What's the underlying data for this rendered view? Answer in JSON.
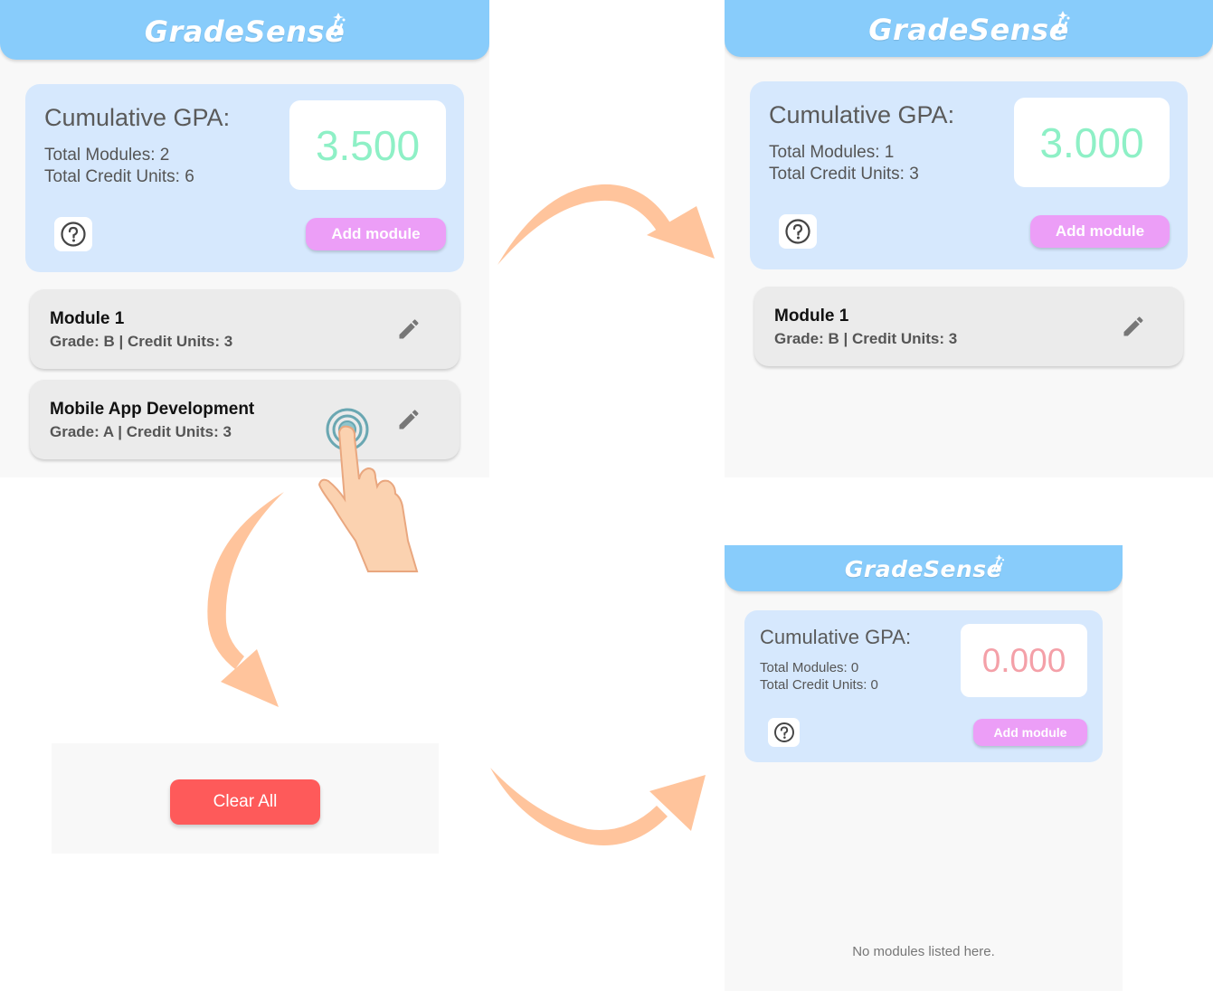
{
  "app": {
    "name": "GradeSense"
  },
  "colors": {
    "header": "#88ccfb",
    "card": "#d6e8fd",
    "add_button": "#ec9ef7",
    "gpa_high": "#8ef0c6",
    "gpa_zero": "#f4a0a8",
    "clear_button": "#fe5a5a",
    "arrow": "#ffc49c"
  },
  "screen1": {
    "gpa_title": "Cumulative GPA:",
    "total_modules": "Total Modules: 2",
    "total_credits": "Total Credit Units: 6",
    "gpa_value": "3.500",
    "add_label": "Add module",
    "modules": [
      {
        "name": "Module 1",
        "info": "Grade: B | Credit Units: 3"
      },
      {
        "name": "Mobile App Development",
        "info": "Grade: A | Credit Units: 3"
      }
    ]
  },
  "screen2": {
    "gpa_title": "Cumulative GPA:",
    "total_modules": "Total Modules: 1",
    "total_credits": "Total Credit Units: 3",
    "gpa_value": "3.000",
    "add_label": "Add module",
    "modules": [
      {
        "name": "Module 1",
        "info": "Grade: B | Credit Units: 3"
      }
    ]
  },
  "clear_panel": {
    "clear_label": "Clear All"
  },
  "screen3": {
    "gpa_title": "Cumulative GPA:",
    "total_modules": "Total Modules: 0",
    "total_credits": "Total Credit Units: 0",
    "gpa_value": "0.000",
    "add_label": "Add module",
    "empty_message": "No modules listed here."
  },
  "icons": [
    "sparkle-icon",
    "help-icon",
    "pencil-icon",
    "tap-gesture-icon",
    "curved-arrow-icon"
  ]
}
